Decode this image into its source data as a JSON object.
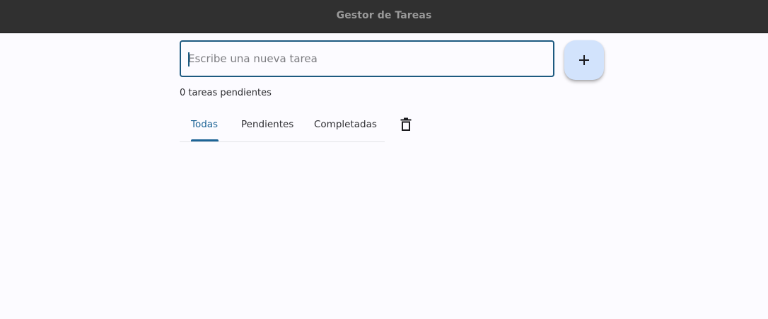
{
  "window": {
    "title": "Gestor de Tareas"
  },
  "task_input": {
    "placeholder": "Escribe una nueva tarea",
    "value": ""
  },
  "add_button": {
    "icon": "plus-icon"
  },
  "counter": {
    "text": "0 tareas pendientes"
  },
  "tabs": [
    {
      "label": "Todas",
      "selected": true
    },
    {
      "label": "Pendientes",
      "selected": false
    },
    {
      "label": "Completadas",
      "selected": false
    }
  ],
  "clear_button": {
    "icon": "trash-icon"
  },
  "colors": {
    "accent": "#1d6496",
    "titlebar": "#303030",
    "background": "#fcfbff",
    "fab": "#d2e3fc"
  }
}
